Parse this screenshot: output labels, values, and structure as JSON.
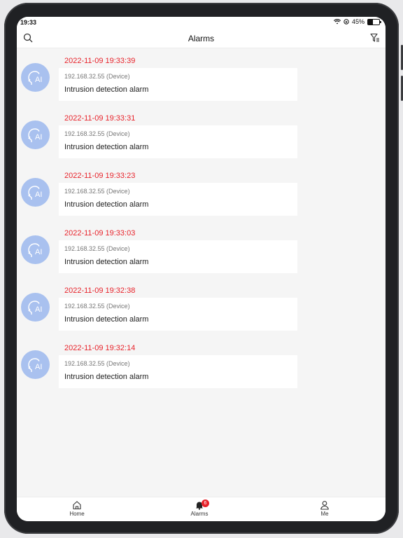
{
  "status": {
    "time": "19:33",
    "battery": "45%"
  },
  "header": {
    "title": "Alarms"
  },
  "alarms": [
    {
      "time": "2022-11-09 19:33:39",
      "device": "192.168.32.55 (Device)",
      "description": "Intrusion detection alarm",
      "icon": "ai-face-icon"
    },
    {
      "time": "2022-11-09 19:33:31",
      "device": "192.168.32.55 (Device)",
      "description": "Intrusion detection alarm",
      "icon": "ai-face-icon"
    },
    {
      "time": "2022-11-09 19:33:23",
      "device": "192.168.32.55 (Device)",
      "description": "Intrusion detection alarm",
      "icon": "ai-face-icon"
    },
    {
      "time": "2022-11-09 19:33:03",
      "device": "192.168.32.55 (Device)",
      "description": "Intrusion detection alarm",
      "icon": "ai-face-icon"
    },
    {
      "time": "2022-11-09 19:32:38",
      "device": "192.168.32.55 (Device)",
      "description": "Intrusion detection alarm",
      "icon": "ai-face-icon"
    },
    {
      "time": "2022-11-09 19:32:14",
      "device": "192.168.32.55 (Device)",
      "description": "Intrusion detection alarm",
      "icon": "ai-face-icon"
    }
  ],
  "tabs": [
    {
      "label": "Home",
      "icon": "home-icon"
    },
    {
      "label": "Alarms",
      "icon": "bell-icon",
      "badge": "6"
    },
    {
      "label": "Me",
      "icon": "person-icon"
    }
  ],
  "colors": {
    "accent": "#e8232b",
    "avatar": "#a9c1ef"
  }
}
